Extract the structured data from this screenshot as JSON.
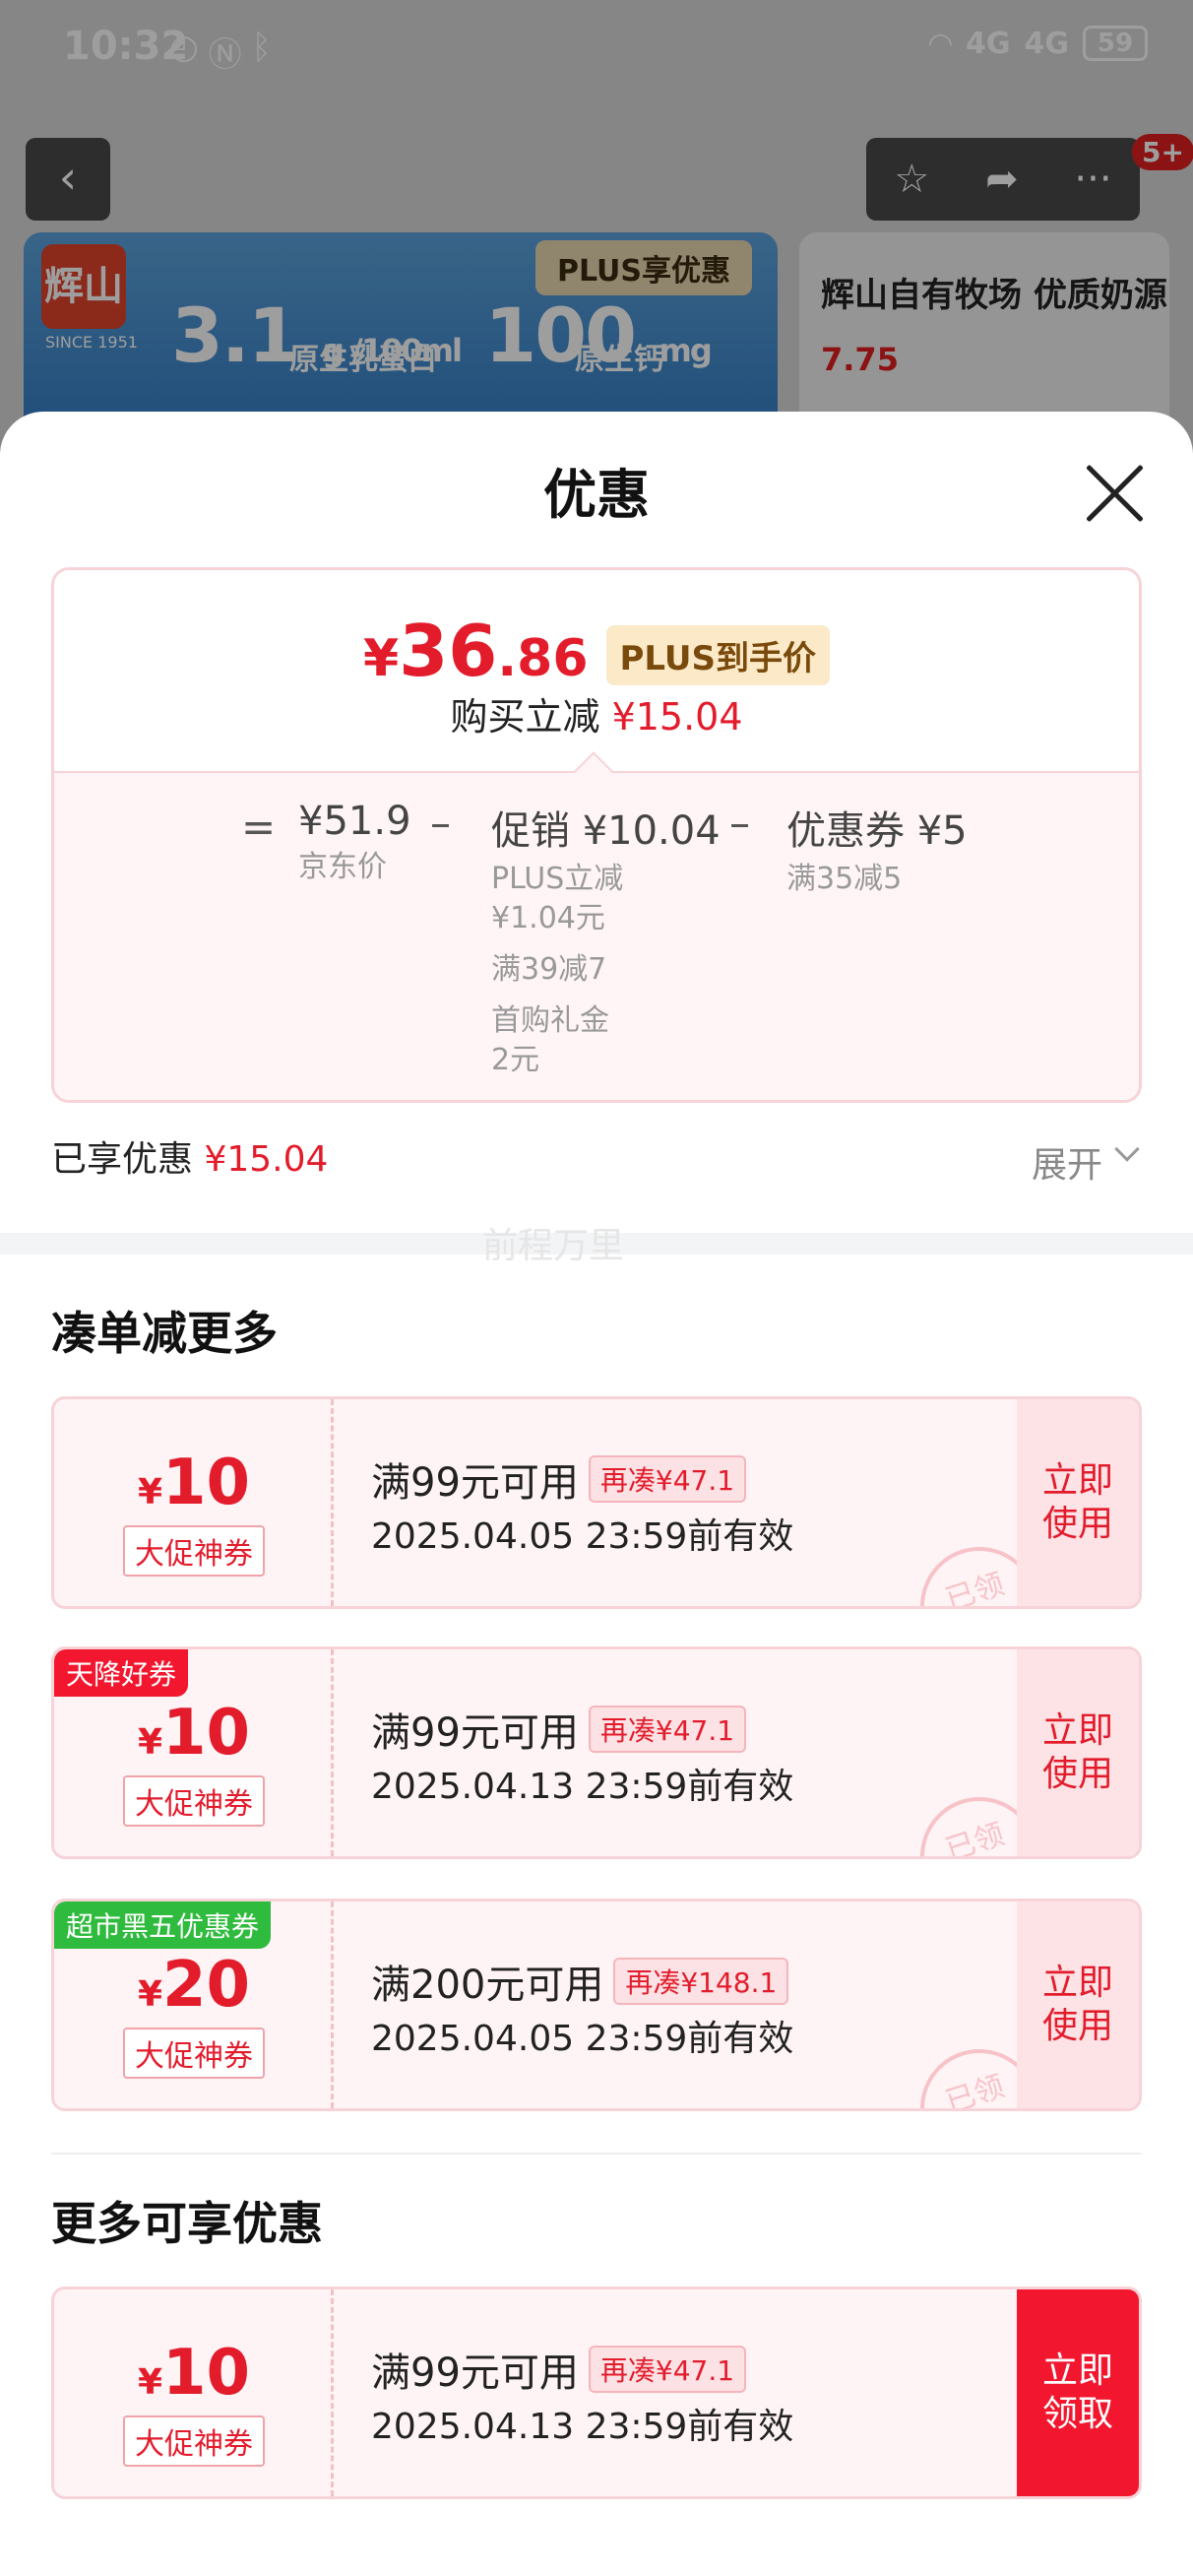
{
  "status_bar": {
    "time": "10:32",
    "left_icons": [
      "timer-icon",
      "nfc-icon",
      "bluetooth-icon"
    ],
    "network_1": "4G",
    "network_2": "4G",
    "battery": "59"
  },
  "product_page": {
    "badge_count": "5+",
    "banner": {
      "brand": "辉山",
      "since": "SINCE 1951",
      "plus_label": "PLUS享优惠",
      "spec_1_value": "3.1",
      "spec_1_unit": "g /100ml",
      "spec_1_name": "原生乳蛋白",
      "spec_2_value": "100",
      "spec_2_unit": "mg /100ml",
      "spec_2_name": "原生钙"
    },
    "side_banner": {
      "title": "辉山自有牧场 优质奶源",
      "price": "7.75"
    }
  },
  "sheet": {
    "title": "优惠",
    "price_card": {
      "currency": "¥",
      "price_int": "36",
      "price_dec": ".86",
      "plus_tag": "PLUS到手价",
      "reduce_label": "购买立减",
      "reduce_amount": "¥15.04",
      "calc": {
        "eq": "=",
        "jd_price": "¥51.9",
        "jd_label": "京东价",
        "op_1": "–",
        "promo_head": "促销 ¥10.04",
        "promo_items": [
          "PLUS立减",
          "¥1.04元",
          "满39减7",
          "首购礼金",
          "2元"
        ],
        "op_2": "–",
        "coupon_head": "优惠券 ¥5",
        "coupon_sub": "满35减5"
      }
    },
    "enjoyed_label": "已享优惠",
    "enjoyed_amount": "¥15.04",
    "expand_label": "展开",
    "watermark": "前程万里",
    "section_1_title": "凑单减更多",
    "section_2_title": "更多可享优惠",
    "coupons": [
      {
        "sym": "¥",
        "amount": "10",
        "type": "大促神券",
        "cond": "满99元可用",
        "tag": "再凑¥47.1",
        "expire": "2025.04.05 23:59前有效",
        "action": "立即使用",
        "stamp": "已领",
        "ribbon": ""
      },
      {
        "sym": "¥",
        "amount": "10",
        "type": "大促神券",
        "cond": "满99元可用",
        "tag": "再凑¥47.1",
        "expire": "2025.04.13 23:59前有效",
        "action": "立即使用",
        "stamp": "已领",
        "ribbon": "天降好券"
      },
      {
        "sym": "¥",
        "amount": "20",
        "type": "大促神券",
        "cond": "满200元可用",
        "tag": "再凑¥148.1",
        "expire": "2025.04.05 23:59前有效",
        "action": "立即使用",
        "stamp": "已领",
        "ribbon": "超市黑五优惠券"
      },
      {
        "sym": "¥",
        "amount": "10",
        "type": "大促神券",
        "cond": "满99元可用",
        "tag": "再凑¥47.1",
        "expire": "2025.04.13 23:59前有效",
        "action": "立即领取",
        "stamp": "",
        "ribbon": ""
      }
    ]
  },
  "colors": {
    "accent_red": "#e31c2c",
    "claim_red": "#f2162e",
    "ribbon_green": "#2fbb3d",
    "plus_gold": "#fbe9c8"
  }
}
